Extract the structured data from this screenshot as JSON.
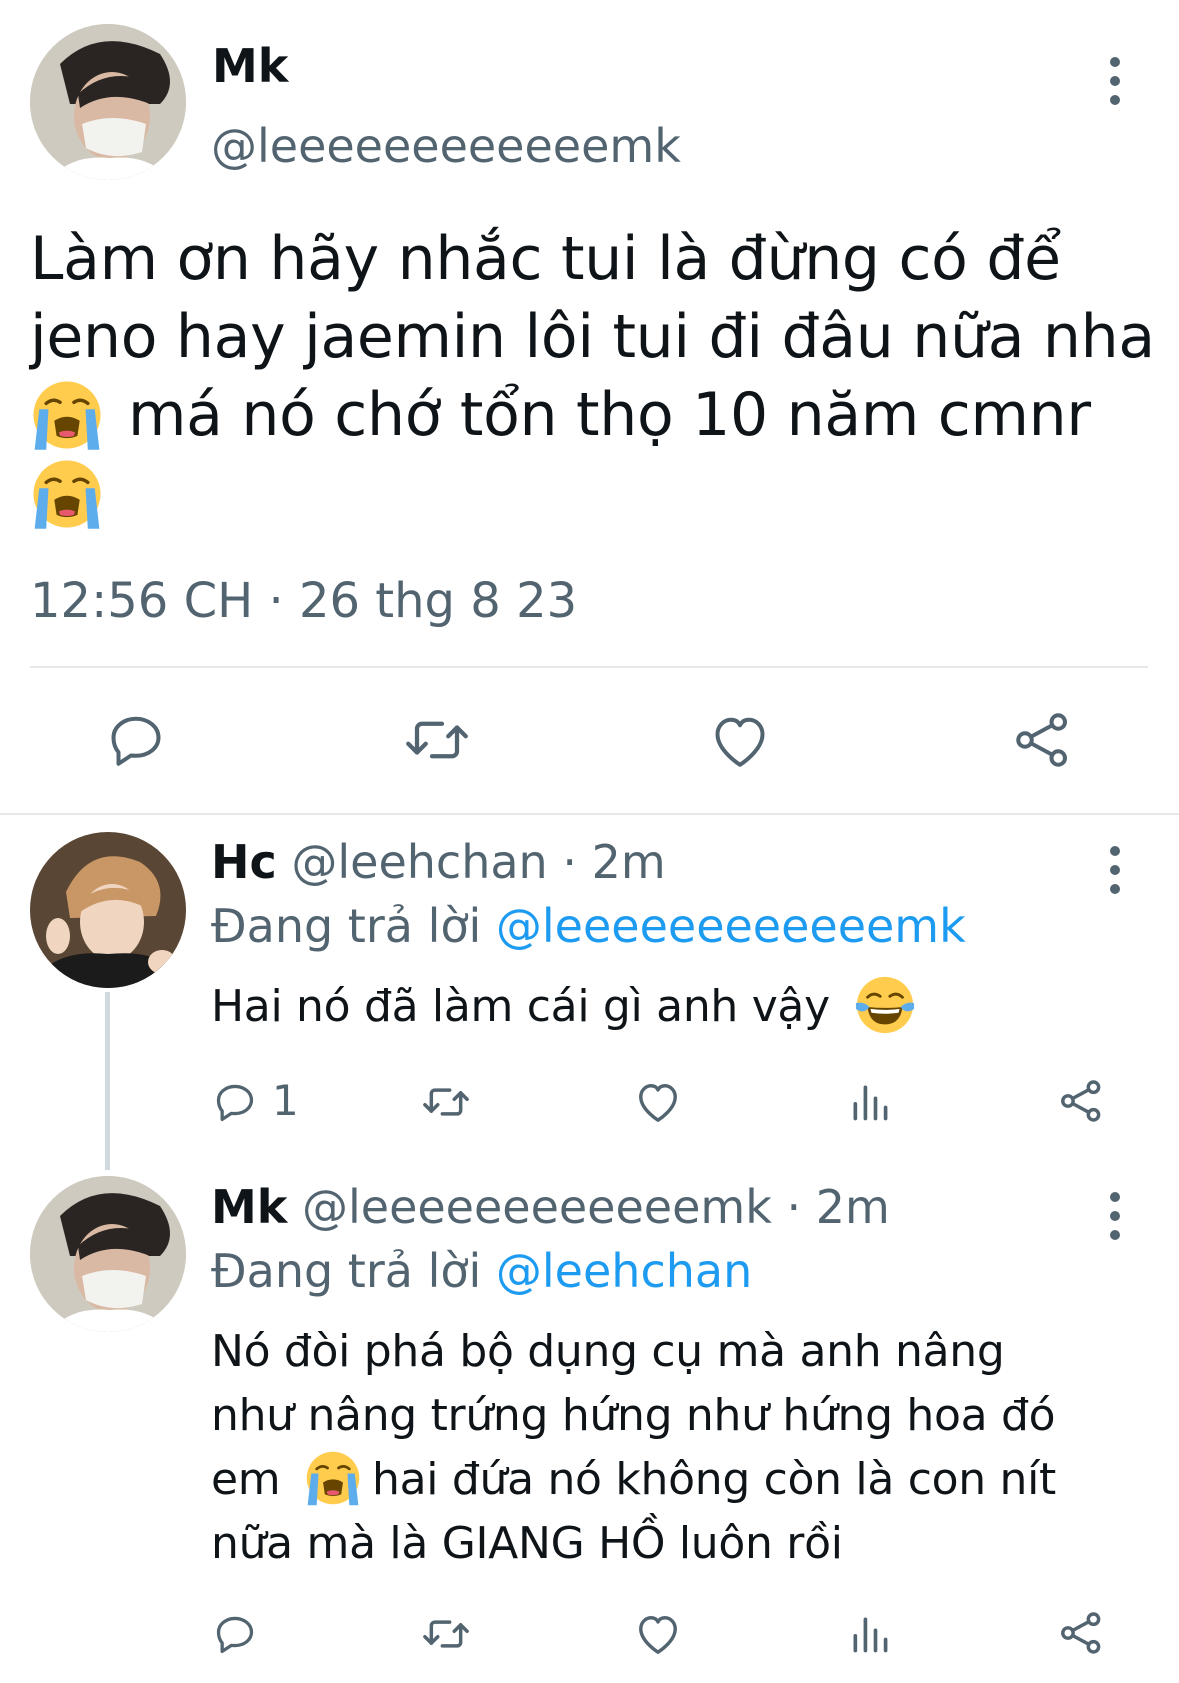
{
  "main_tweet": {
    "display_name": "Mk",
    "handle": "@leeeeeeeeeeeemk",
    "text_line1": "Làm ơn hãy nhắc tui là đừng có để",
    "text_line2": "jeno hay jaemin lôi tui đi đâu nữa nha",
    "text_line3": "má nó chớ tổn thọ 10 năm cmnr",
    "timestamp": "12:56 CH · 26 thg 8 23",
    "actions": [
      "reply-icon",
      "retweet-icon",
      "like-icon",
      "share-icon"
    ]
  },
  "replies": [
    {
      "display_name": "Hc",
      "handle": "@leehchan",
      "time": "· 2m",
      "replying_prefix": "Đang trả lời",
      "replying_to": "@leeeeeeeeeeeemk",
      "text": "Hai nó đã làm cái gì anh vậy",
      "reply_count": "1"
    },
    {
      "display_name": "Mk",
      "handle": "@leeeeeeeeeeeemk",
      "time": "· 2m",
      "replying_prefix": "Đang trả lời",
      "replying_to": "@leehchan",
      "text_line1": "Nó đòi phá bộ dụng cụ mà anh nâng",
      "text_line2": "như nâng trứng hứng như hứng hoa đó",
      "text_line3_a": "em",
      "text_line3_b": "hai đứa nó không còn là con nít",
      "text_line4": "nữa mà là GIANG HỒ luôn rồi"
    }
  ],
  "colors": {
    "link": "#1d9bf0",
    "secondary_text": "#536471",
    "divider": "#e6e9eb"
  }
}
